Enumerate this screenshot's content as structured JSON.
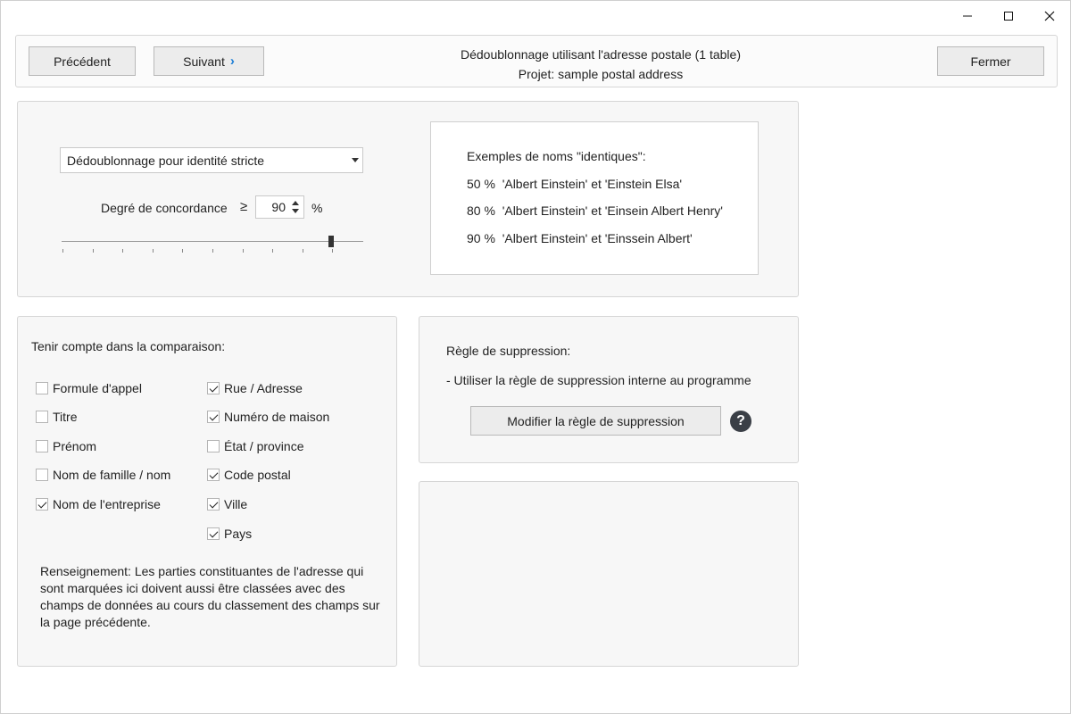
{
  "window": {
    "minimize_icon": "minimize-icon",
    "maximize_icon": "maximize-icon",
    "close_icon": "close-icon"
  },
  "header": {
    "prev_label": "Précédent",
    "next_label": "Suivant",
    "title_line1": "Dédoublonnage utilisant l'adresse postale (1 table)",
    "title_line2": "Projet: sample postal address",
    "close_label": "Fermer"
  },
  "matching": {
    "mode_selected": "Dédoublonnage pour identité stricte",
    "degree_label": "Degré de concordance",
    "ge_symbol": "≥",
    "degree_value": "90",
    "percent_symbol": "%",
    "slider_fraction": 0.9
  },
  "examples": {
    "title": "Exemples de noms \"identiques\":",
    "rows": [
      "50 %  'Albert Einstein' et 'Einstein Elsa'",
      "80 %  'Albert Einstein' et 'Einsein Albert Henry'",
      "90 %  'Albert Einstein' et 'Einssein Albert'"
    ]
  },
  "comparison": {
    "title": "Tenir compte dans la comparaison:",
    "left": [
      {
        "label": "Formule d'appel",
        "checked": false
      },
      {
        "label": "Titre",
        "checked": false
      },
      {
        "label": "Prénom",
        "checked": false
      },
      {
        "label": "Nom de famille / nom",
        "checked": false
      },
      {
        "label": "Nom de l'entreprise",
        "checked": true
      }
    ],
    "right": [
      {
        "label": "Rue / Adresse",
        "checked": true
      },
      {
        "label": "Numéro de maison",
        "checked": true
      },
      {
        "label": "État / province",
        "checked": false
      },
      {
        "label": "Code postal",
        "checked": true
      },
      {
        "label": "Ville",
        "checked": true
      },
      {
        "label": "Pays",
        "checked": true
      }
    ],
    "info": "Renseignement: Les parties constituantes de l'adresse qui sont marquées ici doivent aussi être classées avec des champs de données au cours du classement des champs sur la page précédente."
  },
  "rule": {
    "title": "Règle de suppression:",
    "text": "- Utiliser la règle de suppression interne au programme",
    "button_label": "Modifier la règle de suppression",
    "help_glyph": "?"
  }
}
